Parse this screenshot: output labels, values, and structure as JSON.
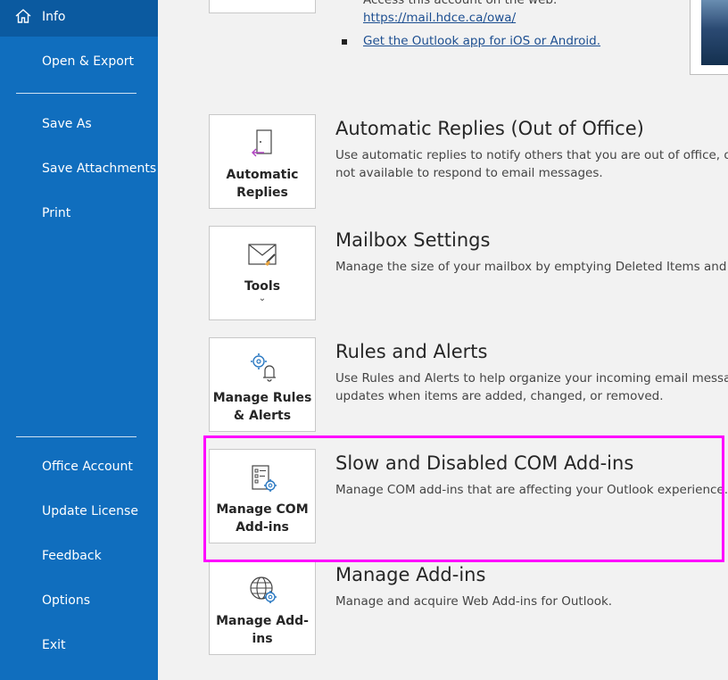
{
  "sidebar": {
    "items": [
      {
        "label": "Info"
      },
      {
        "label": "Open & Export"
      },
      {
        "label": "Save As"
      },
      {
        "label": "Save Attachments"
      },
      {
        "label": "Print"
      },
      {
        "label": "Office Account"
      },
      {
        "label": "Update License"
      },
      {
        "label": "Feedback"
      },
      {
        "label": "Options"
      },
      {
        "label": "Exit"
      }
    ]
  },
  "account": {
    "web_access_text": "Access this account on the web.",
    "owa_link": "https://mail.hdce.ca/owa/",
    "app_link": "Get the Outlook app for iOS or Android."
  },
  "sections": [
    {
      "card_label_1": "Automatic",
      "card_label_2": "Replies",
      "title": "Automatic Replies (Out of Office)",
      "desc_1": "Use automatic replies to notify others that you are out of office, on",
      "desc_2": "not available to respond to email messages."
    },
    {
      "card_label_1": "Tools",
      "title": "Mailbox Settings",
      "desc_1": "Manage the size of your mailbox by emptying Deleted Items and a"
    },
    {
      "card_label_1": "Manage Rules",
      "card_label_2": "& Alerts",
      "title": "Rules and Alerts",
      "desc_1": "Use Rules and Alerts to help organize your incoming email messag",
      "desc_2": "updates when items are added, changed, or removed."
    },
    {
      "card_label_1": "Manage COM",
      "card_label_2": "Add-ins",
      "title": "Slow and Disabled COM Add-ins",
      "desc_1": "Manage COM add-ins that are affecting your Outlook experience."
    },
    {
      "card_label_1": "Manage Add-",
      "card_label_2": "ins",
      "title": "Manage Add-ins",
      "desc_1": "Manage and acquire Web Add-ins for Outlook."
    }
  ],
  "colors": {
    "sidebar": "#106ebe",
    "sidebar_active": "#0b5aa0",
    "highlight": "#ff00ff",
    "link": "#1d4f91"
  }
}
